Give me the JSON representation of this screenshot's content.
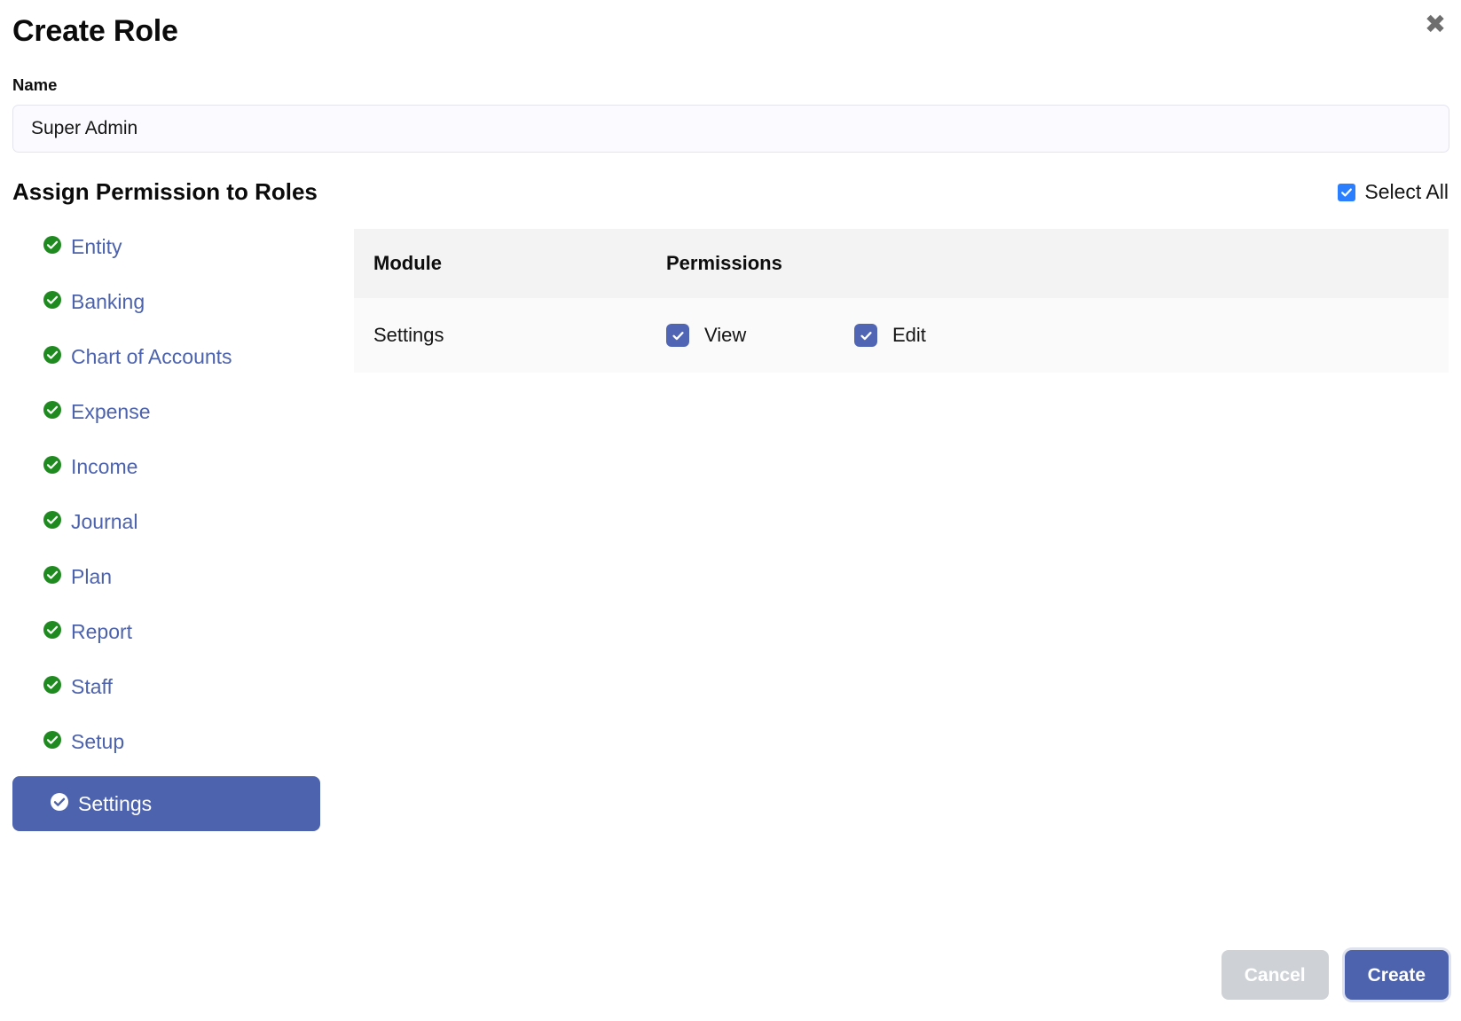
{
  "header": {
    "title": "Create Role",
    "close_icon": "close-icon"
  },
  "name_field": {
    "label": "Name",
    "value": "Super Admin",
    "placeholder": "Name"
  },
  "assign": {
    "title": "Assign Permission to Roles",
    "select_all_label": "Select All",
    "select_all_checked": true,
    "select_all_color": "#2b7fff"
  },
  "modules": [
    {
      "label": "Entity",
      "icon": "check-circle-icon",
      "active": false
    },
    {
      "label": "Banking",
      "icon": "check-circle-icon",
      "active": false
    },
    {
      "label": "Chart of Accounts",
      "icon": "check-circle-icon",
      "active": false
    },
    {
      "label": "Expense",
      "icon": "check-circle-icon",
      "active": false
    },
    {
      "label": "Income",
      "icon": "check-circle-icon",
      "active": false
    },
    {
      "label": "Journal",
      "icon": "check-circle-icon",
      "active": false
    },
    {
      "label": "Plan",
      "icon": "check-circle-icon",
      "active": false
    },
    {
      "label": "Report",
      "icon": "check-circle-icon",
      "active": false
    },
    {
      "label": "Staff",
      "icon": "check-circle-icon",
      "active": false
    },
    {
      "label": "Setup",
      "icon": "check-circle-icon",
      "active": false
    },
    {
      "label": "Settings",
      "icon": "check-circle-icon",
      "active": true
    }
  ],
  "table": {
    "columns": [
      "Module",
      "Permissions"
    ],
    "rows": [
      {
        "module": "Settings",
        "permissions": [
          {
            "label": "View",
            "checked": true
          },
          {
            "label": "Edit",
            "checked": true
          }
        ]
      }
    ]
  },
  "footer": {
    "cancel_label": "Cancel",
    "create_label": "Create"
  },
  "colors": {
    "accent": "#4d63ad",
    "check_green": "#1f8a1f",
    "select_all_blue": "#2b7fff",
    "cancel_gray": "#ced2d7",
    "link_blue": "#4c62ad"
  }
}
